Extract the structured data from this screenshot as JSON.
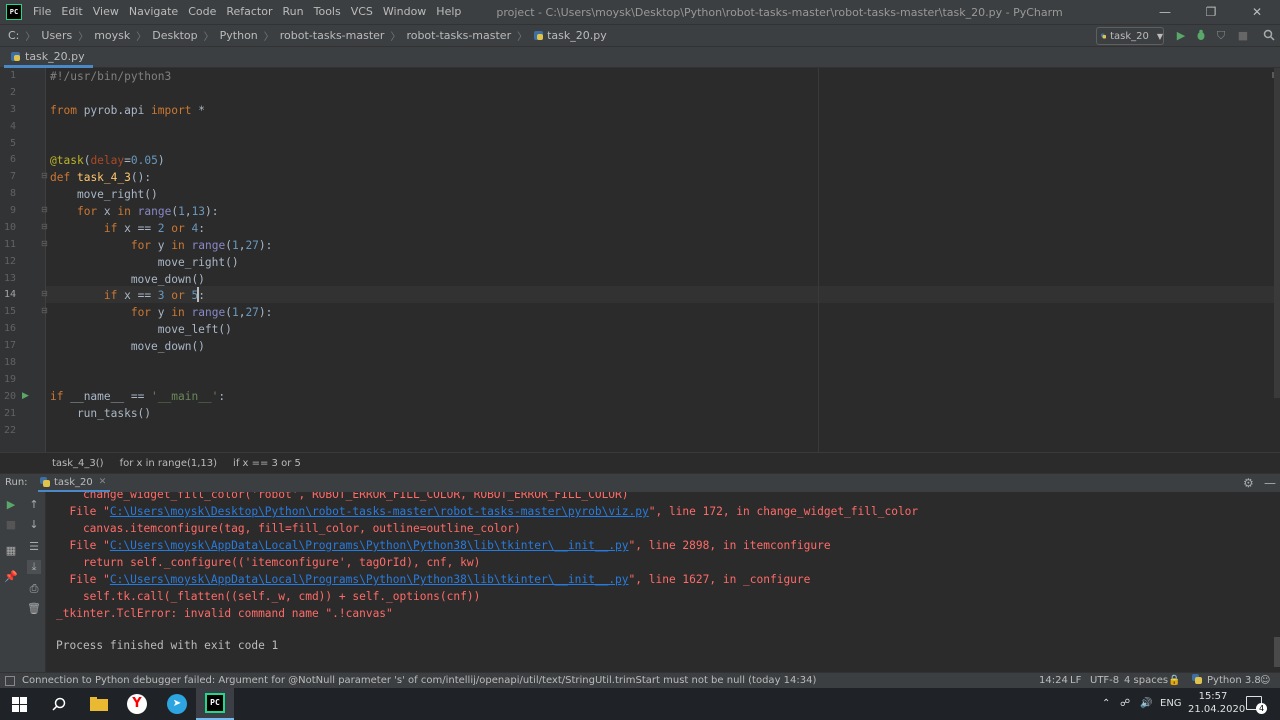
{
  "app": {
    "logo_text": "PC",
    "window_title": "project - C:\\Users\\moysk\\Desktop\\Python\\robot-tasks-master\\robot-tasks-master\\task_20.py - PyCharm"
  },
  "menu": [
    "File",
    "Edit",
    "View",
    "Navigate",
    "Code",
    "Refactor",
    "Run",
    "Tools",
    "VCS",
    "Window",
    "Help"
  ],
  "window_controls": {
    "minimize": "—",
    "maximize": "❐",
    "close": "✕"
  },
  "breadcrumbs": [
    "C:",
    "Users",
    "moysk",
    "Desktop",
    "Python",
    "robot-tasks-master",
    "robot-tasks-master",
    "task_20.py"
  ],
  "run_config": {
    "label": "task_20"
  },
  "editor_tab": {
    "label": "task_20.py"
  },
  "code_breadcrumbs": [
    "task_4_3()",
    "for x in range(1,13)",
    "if x == 3 or 5"
  ],
  "line_numbers": [
    "1",
    "2",
    "3",
    "4",
    "5",
    "6",
    "7",
    "8",
    "9",
    "10",
    "11",
    "12",
    "13",
    "14",
    "15",
    "16",
    "17",
    "18",
    "19",
    "20",
    "21",
    "22"
  ],
  "run_panel": {
    "label": "Run:",
    "tab": "task_20"
  },
  "console_lines": [
    "    change_widget_fill_color('robot', ROBOT_ERROR_FILL_COLOR, ROBOT_ERROR_FILL_COLOR)",
    "  File \"",
    "C:\\Users\\moysk\\Desktop\\Python\\robot-tasks-master\\robot-tasks-master\\pyrob\\viz.py",
    "\", line 172, in change_widget_fill_color",
    "    canvas.itemconfigure(tag, fill=fill_color, outline=outline_color)",
    "  File \"",
    "C:\\Users\\moysk\\AppData\\Local\\Programs\\Python\\Python38\\lib\\tkinter\\__init__.py",
    "\", line 2898, in itemconfigure",
    "    return self._configure(('itemconfigure', tagOrId), cnf, kw)",
    "  File \"",
    "C:\\Users\\moysk\\AppData\\Local\\Programs\\Python\\Python38\\lib\\tkinter\\__init__.py",
    "\", line 1627, in _configure",
    "    self.tk.call(_flatten((self._w, cmd)) + self._options(cnf))",
    "_tkinter.TclError: invalid command name \".!canvas\"",
    "Process finished with exit code 1"
  ],
  "status": {
    "message": "Connection to Python debugger failed: Argument for @NotNull parameter 's' of com/intellij/openapi/util/text/StringUtil.trimStart must not be null (today 14:34)",
    "position": "14:24",
    "line_sep": "LF",
    "encoding": "UTF-8",
    "indent": "4 spaces",
    "interpreter": "Python 3.8"
  },
  "taskbar": {
    "lang": "ENG",
    "time": "15:57",
    "date": "21.04.2020",
    "notif_count": "4"
  }
}
